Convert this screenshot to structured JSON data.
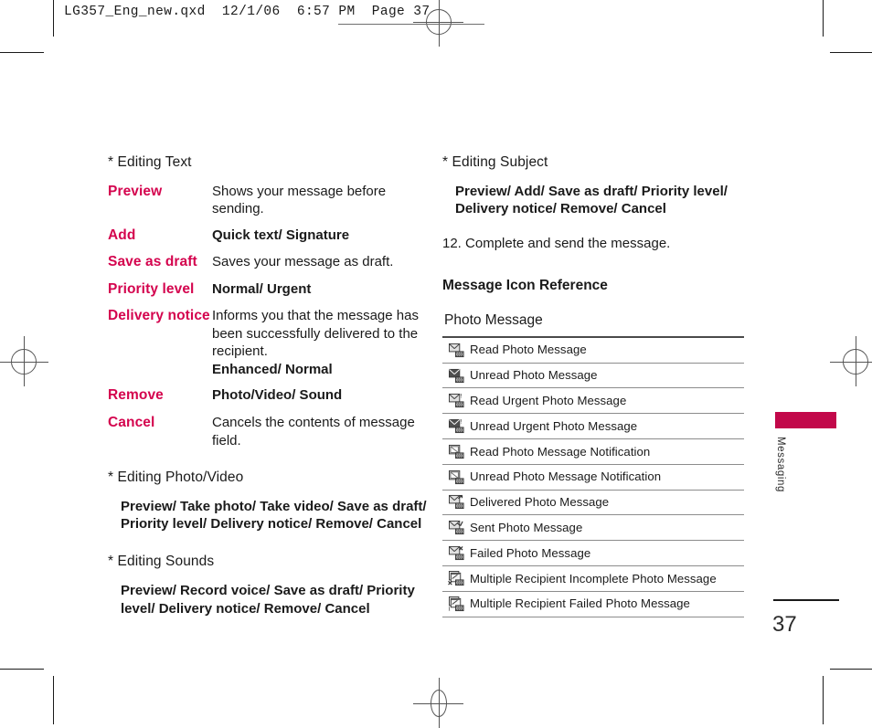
{
  "page": {
    "slug": "LG357_Eng_new.qxd  12/1/06  6:57 PM  Page 37",
    "folio": "37",
    "tab_label": "Messaging",
    "accent_pink": "#d4044e",
    "tab_bar_color": "#c2084a"
  },
  "left_column": {
    "editing_text_heading": "* Editing Text",
    "definitions": [
      {
        "term": "Preview",
        "desc": "Shows your message before sending.",
        "bold": false,
        "extra": ""
      },
      {
        "term": "Add",
        "desc": "Quick text/ Signature",
        "bold": true,
        "extra": ""
      },
      {
        "term": "Save as draft",
        "desc": "Saves your message as draft.",
        "bold": false,
        "extra": ""
      },
      {
        "term": "Priority level",
        "desc": "Normal/ Urgent",
        "bold": true,
        "extra": ""
      },
      {
        "term": "Delivery notice",
        "desc": "Informs you that the message has been successfully delivered to the recipient.",
        "bold": false,
        "extra": "Enhanced/ Normal"
      },
      {
        "term": "Remove",
        "desc": "Photo/Video/ Sound",
        "bold": true,
        "extra": ""
      },
      {
        "term": "Cancel",
        "desc": "Cancels the contents of message field.",
        "bold": false,
        "extra": ""
      }
    ],
    "editing_photo_video_heading": "* Editing Photo/Video",
    "editing_photo_video_options": "Preview/ Take photo/ Take video/ Save as draft/ Priority level/ Delivery notice/ Remove/ Cancel",
    "editing_sounds_heading": "* Editing Sounds",
    "editing_sounds_options": "Preview/ Record voice/ Save as draft/ Priority level/ Delivery notice/ Remove/ Cancel"
  },
  "right_column": {
    "editing_subject_heading": "* Editing Subject",
    "editing_subject_options": "Preview/ Add/ Save as draft/ Priority level/ Delivery notice/ Remove/ Cancel",
    "step_12": "12. Complete and send the message.",
    "icon_reference_heading": "Message Icon Reference",
    "table": {
      "title": "Photo Message",
      "rows": [
        {
          "icon": "read-photo-message-icon",
          "label": "Read Photo Message"
        },
        {
          "icon": "unread-photo-message-icon",
          "label": "Unread Photo Message"
        },
        {
          "icon": "read-urgent-photo-message-icon",
          "label": "Read Urgent Photo Message"
        },
        {
          "icon": "unread-urgent-photo-message-icon",
          "label": "Unread Urgent Photo Message"
        },
        {
          "icon": "read-photo-message-notification-icon",
          "label": "Read Photo Message Notification"
        },
        {
          "icon": "unread-photo-message-notification-icon",
          "label": "Unread Photo Message Notification"
        },
        {
          "icon": "delivered-photo-message-icon",
          "label": "Delivered Photo Message"
        },
        {
          "icon": "sent-photo-message-icon",
          "label": "Sent Photo Message"
        },
        {
          "icon": "failed-photo-message-icon",
          "label": "Failed Photo Message"
        },
        {
          "icon": "multiple-recipient-incomplete-photo-message-icon",
          "label": "Multiple Recipient Incomplete Photo Message"
        },
        {
          "icon": "multiple-recipient-failed-photo-message-icon",
          "label": "Multiple Recipient Failed Photo Message"
        }
      ]
    }
  }
}
